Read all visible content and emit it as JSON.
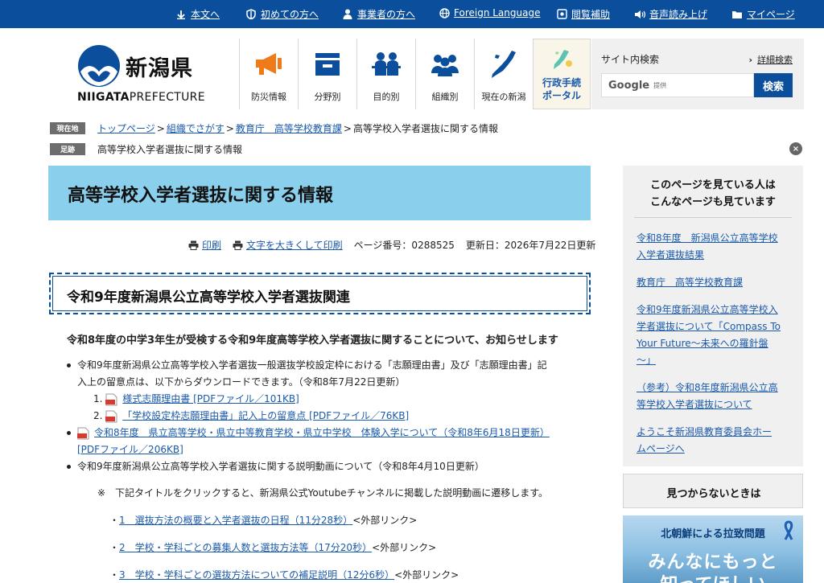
{
  "utility": {
    "items": [
      {
        "label": "本文へ",
        "icon": "arrow-down-icon"
      },
      {
        "label": "初めての方へ",
        "icon": "shield-icon"
      },
      {
        "label": "事業者の方へ",
        "icon": "person-icon"
      },
      {
        "label": "Foreign Language",
        "icon": "globe-icon"
      },
      {
        "label": "閲覧補助",
        "icon": "screen-icon"
      },
      {
        "label": "音声読み上げ",
        "icon": "speaker-icon"
      },
      {
        "label": "マイページ",
        "icon": "folder-icon"
      }
    ]
  },
  "logo": {
    "jp": "新潟県",
    "en_bold": "NIIGATA",
    "en_light": "PREFECTURE"
  },
  "gnav": {
    "items": [
      {
        "label": "防災情報",
        "icon": "megaphone-icon"
      },
      {
        "label": "分野別",
        "icon": "inbox-icon"
      },
      {
        "label": "目的別",
        "icon": "people-icon"
      },
      {
        "label": "組織別",
        "icon": "group-icon"
      },
      {
        "label": "現在の新潟",
        "icon": "niigata-map-icon"
      }
    ],
    "portal": {
      "line1": "行政手続",
      "line2": "ポータル"
    }
  },
  "search": {
    "title": "サイト内検索",
    "advanced": "詳細検索",
    "google": "Google",
    "provided": "提供",
    "button": "検索"
  },
  "breadcrumb": {
    "current_tag": "現在地",
    "links": [
      "トップページ",
      "組織でさがす",
      "教育庁　高等学校教育課"
    ],
    "current": "高等学校入学者選抜に関する情報",
    "history_tag": "足跡",
    "history": "高等学校入学者選抜に関する情報",
    "close": "×"
  },
  "page": {
    "title": "高等学校入学者選抜に関する情報",
    "print": "印刷",
    "print_large": "文字を大きくして印刷",
    "page_number": "ページ番号：0288525",
    "updated": "更新日：2026年7月22日更新",
    "h2": "令和9年度新潟県公立高等学校入学者選抜関連",
    "lead": "令和8年度の中学3年生が受検する令和9年度高等学校入学者選抜に関することについて、お知らせします",
    "b1_l1": "令和9年度新潟県公立高等学校入学者選抜一般選抜学校設定枠における「志願理由書」及び「志願理由書」記",
    "b1_l2": "入上の留意点は、以下からダウンロードできます。（令和8年7月22日更新）",
    "n1": "1.",
    "n1_link": "様式志願理由書 [PDFファイル／101KB]",
    "n2": "2.",
    "n2_link": "「学校設定枠志願理由書」記入上の留意点 [PDFファイル／76KB]",
    "b2_l1": "令和8年度　県立高等学校・県立中等教育学校・県立中学校　体験入学について（令和8年6月18日更新）",
    "b2_l2": "[PDFファイル／206KB]",
    "b3": "令和9年度新潟県公立高等学校入学者選抜に関する説明動画について（令和8年4月10日更新）",
    "note": "※　下記タイトルをクリックすると、新潟県公式Youtubeチャンネルに掲載した説明動画に遷移します。",
    "v1_link": "1　選抜方法の概要と入学者選抜の日程（11分28秒）",
    "v2_link": "2　学校・学科ごとの募集人数と選抜方法等（17分20秒）",
    "v3_link": "3　学校・学科ごとの選抜方法についての補足説明（12分6秒）",
    "external": "<外部リンク>",
    "bullet_mark": "・"
  },
  "sidebar": {
    "heading_l1": "このページを見ている人は",
    "heading_l2": "こんなページも見ています",
    "links": [
      [
        "令和8年度　新潟県公立高等学校",
        "入学者選抜結果"
      ],
      [
        "教育庁　高等学校教育課"
      ],
      [
        "令和9年度新潟県公立高等学校入",
        "学者選抜について「Compass To",
        "Your Future～未来への羅針盤",
        "～」"
      ],
      [
        "（参考）令和8年度新潟県公立高",
        "等学校入学者選抜について"
      ],
      [
        "ようこそ新潟県教育委員会ホー",
        "ムページへ"
      ]
    ],
    "notfound": "見つからないときは",
    "banner_l1": "北朝鮮による拉致問題",
    "banner_l2": "みんなにもっと",
    "banner_l3": "知ってほしい"
  },
  "colors": {
    "brand": "#0b4f9c",
    "banner": "#8ad0ec",
    "link": "#1a5aab"
  }
}
